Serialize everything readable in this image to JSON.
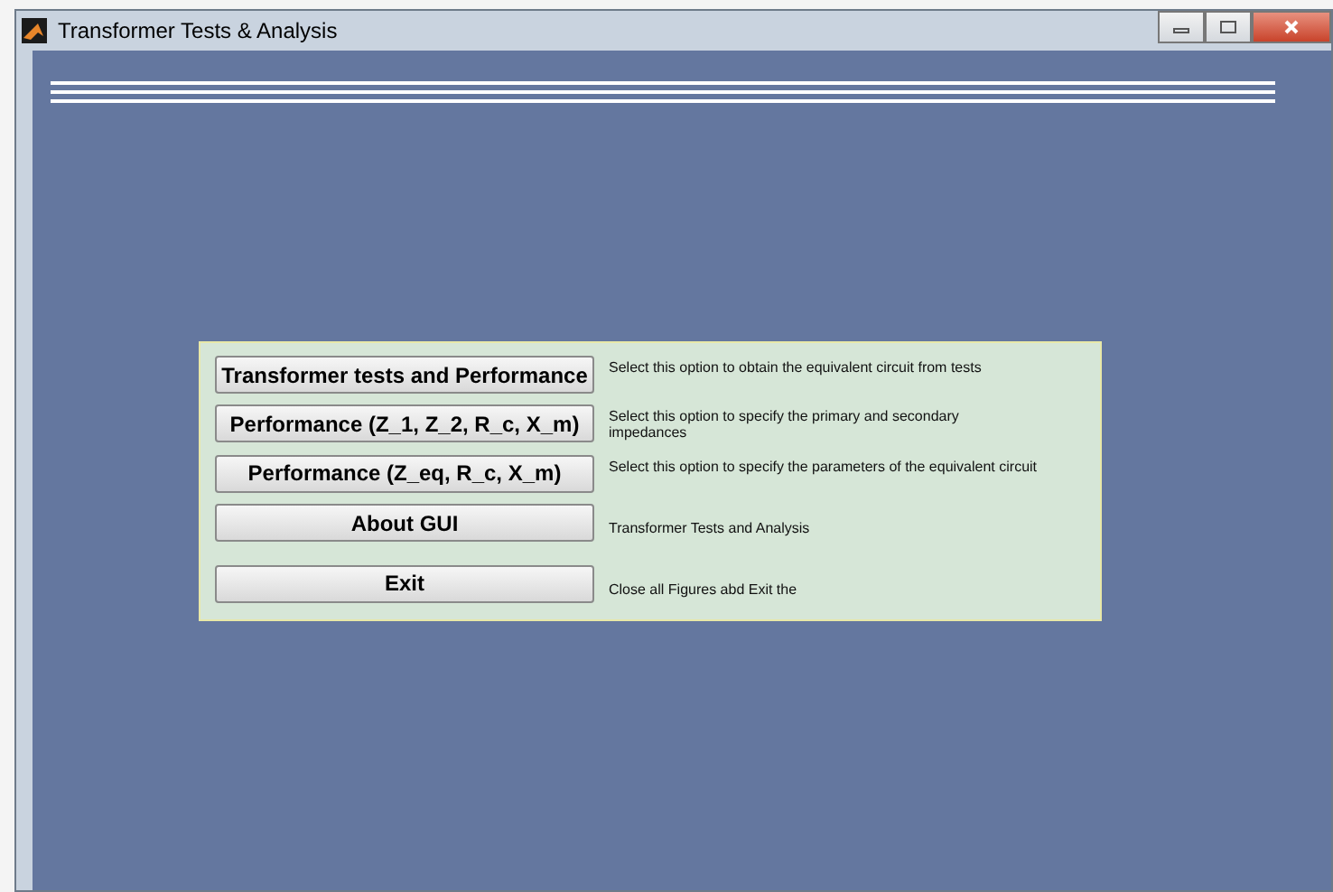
{
  "window": {
    "title": "Transformer Tests & Analysis"
  },
  "options": [
    {
      "button": "Transformer tests and Performance",
      "description": "Select this option to obtain the equivalent circuit from tests"
    },
    {
      "button": "Performance (Z_1, Z_2, R_c, X_m)",
      "description": "Select this option to specify the primary and secondary impedances"
    },
    {
      "button": "Performance (Z_eq, R_c, X_m)",
      "description": "Select this option to specify the parameters of the equivalent circuit"
    },
    {
      "button": "About GUI",
      "description": "Transformer Tests and Analysis"
    },
    {
      "button": "Exit",
      "description": "Close all Figures abd Exit the"
    }
  ]
}
